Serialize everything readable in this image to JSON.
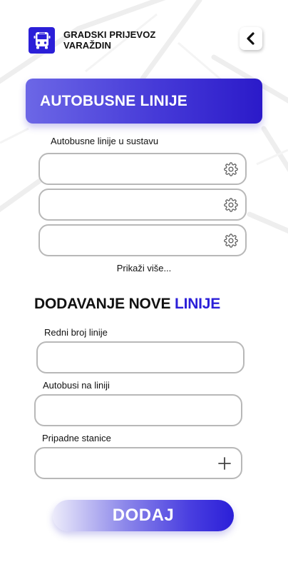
{
  "app": {
    "title_line1": "GRADSKI PRIJEVOZ",
    "title_line2": "VARAŽDIN",
    "logo_icon": "bus-icon",
    "back_icon": "chevron-left-icon"
  },
  "banner": {
    "title": "AUTOBUSNE LINIJE"
  },
  "lines_section": {
    "label": "Autobusne linije u sustavu",
    "items": [
      {
        "value": "",
        "action_icon": "gear-icon"
      },
      {
        "value": "",
        "action_icon": "gear-icon"
      },
      {
        "value": "",
        "action_icon": "gear-icon"
      }
    ],
    "show_more": "Prikaži više..."
  },
  "new_line_section": {
    "title_part1": "DODAVANJE NOVE",
    "title_part2": "LINIJE",
    "fields": {
      "line_number": {
        "label": "Redni broj linije",
        "value": ""
      },
      "buses": {
        "label": "Autobusi na liniji",
        "value": ""
      },
      "stations": {
        "label": "Pripadne stanice",
        "value": "",
        "action_icon": "plus-icon"
      }
    },
    "submit_label": "DODAJ"
  },
  "colors": {
    "accent": "#2b1fd8",
    "banner_gradient_start": "#6c67e6",
    "banner_gradient_end": "#2b1ac9",
    "field_border": "#b8b8b8"
  }
}
